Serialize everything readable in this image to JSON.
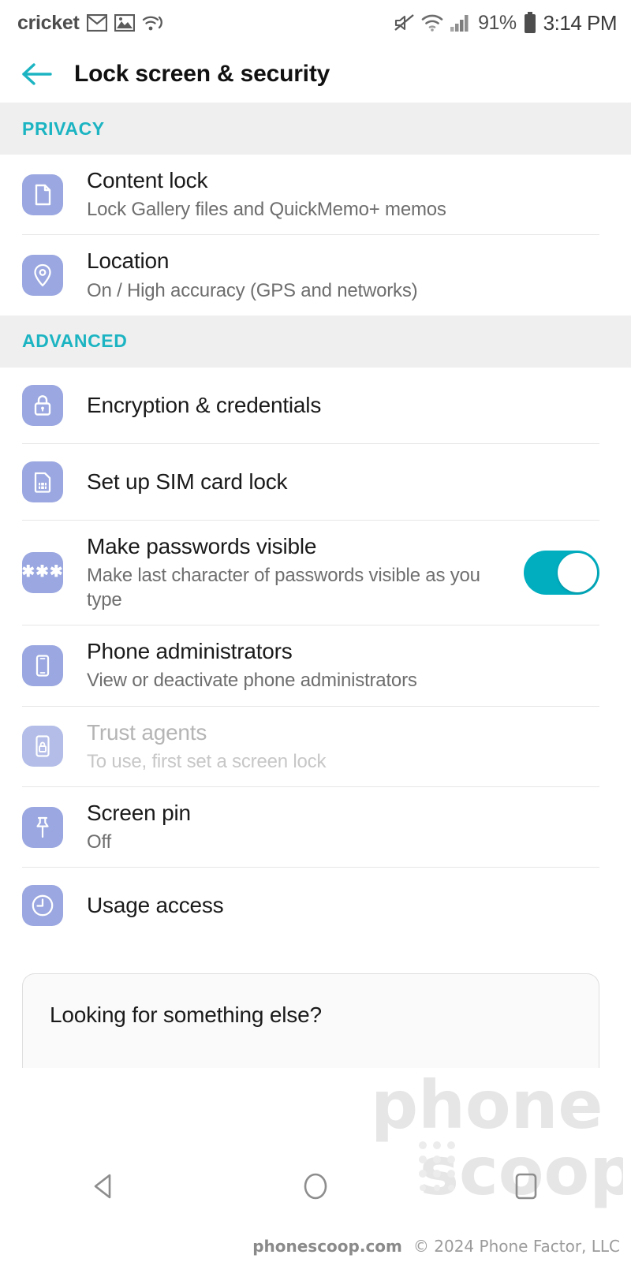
{
  "status_bar": {
    "carrier": "cricket",
    "icons_left": [
      "gmail-icon",
      "photos-icon",
      "wifi-calling-icon"
    ],
    "icons_right": [
      "mute-icon",
      "wifi-icon",
      "cellular-signal-icon"
    ],
    "battery_percent": "91%",
    "battery_icon": "battery-icon",
    "time": "3:14 PM"
  },
  "toolbar": {
    "back_icon": "back-arrow-icon",
    "title": "Lock screen & security"
  },
  "colors": {
    "accent_teal": "#1cb4c2",
    "toggle_on": "#00aec0",
    "icon_tile": "#9aa7e0",
    "section_bg": "#efefef",
    "divider": "#e6e6e6"
  },
  "sections": [
    {
      "header": "PRIVACY",
      "rows": [
        {
          "icon": "document-icon",
          "title": "Content lock",
          "subtitle": "Lock Gallery files and QuickMemo+ memos",
          "disabled": false,
          "toggle": null
        },
        {
          "icon": "location-pin-icon",
          "title": "Location",
          "subtitle": "On / High accuracy (GPS and networks)",
          "disabled": false,
          "toggle": null
        }
      ]
    },
    {
      "header": "ADVANCED",
      "rows": [
        {
          "icon": "lock-icon",
          "title": "Encryption & credentials",
          "subtitle": "",
          "disabled": false,
          "toggle": null
        },
        {
          "icon": "sim-card-icon",
          "title": "Set up SIM card lock",
          "subtitle": "",
          "disabled": false,
          "toggle": null
        },
        {
          "icon": "asterisks-icon",
          "title": "Make passwords visible",
          "subtitle": "Make last character of passwords visible as you type",
          "disabled": false,
          "toggle": "on"
        },
        {
          "icon": "phone-icon",
          "title": "Phone administrators",
          "subtitle": "View or deactivate phone administrators",
          "disabled": false,
          "toggle": null
        },
        {
          "icon": "phone-lock-icon",
          "title": "Trust agents",
          "subtitle": "To use, first set a screen lock",
          "disabled": true,
          "toggle": null
        },
        {
          "icon": "pushpin-icon",
          "title": "Screen pin",
          "subtitle": "Off",
          "disabled": false,
          "toggle": null
        },
        {
          "icon": "clock-icon",
          "title": "Usage access",
          "subtitle": "",
          "disabled": false,
          "toggle": null
        }
      ]
    }
  ],
  "footer_card": {
    "title": "Looking for something else?"
  },
  "watermark": {
    "line1": "phone",
    "line2": "scoop"
  },
  "navbar": {
    "back": "nav-back-icon",
    "home": "nav-home-icon",
    "recents": "nav-recents-icon"
  },
  "page_footer": {
    "site": "phonescoop.com",
    "copyright": "© 2024 Phone Factor, LLC"
  }
}
